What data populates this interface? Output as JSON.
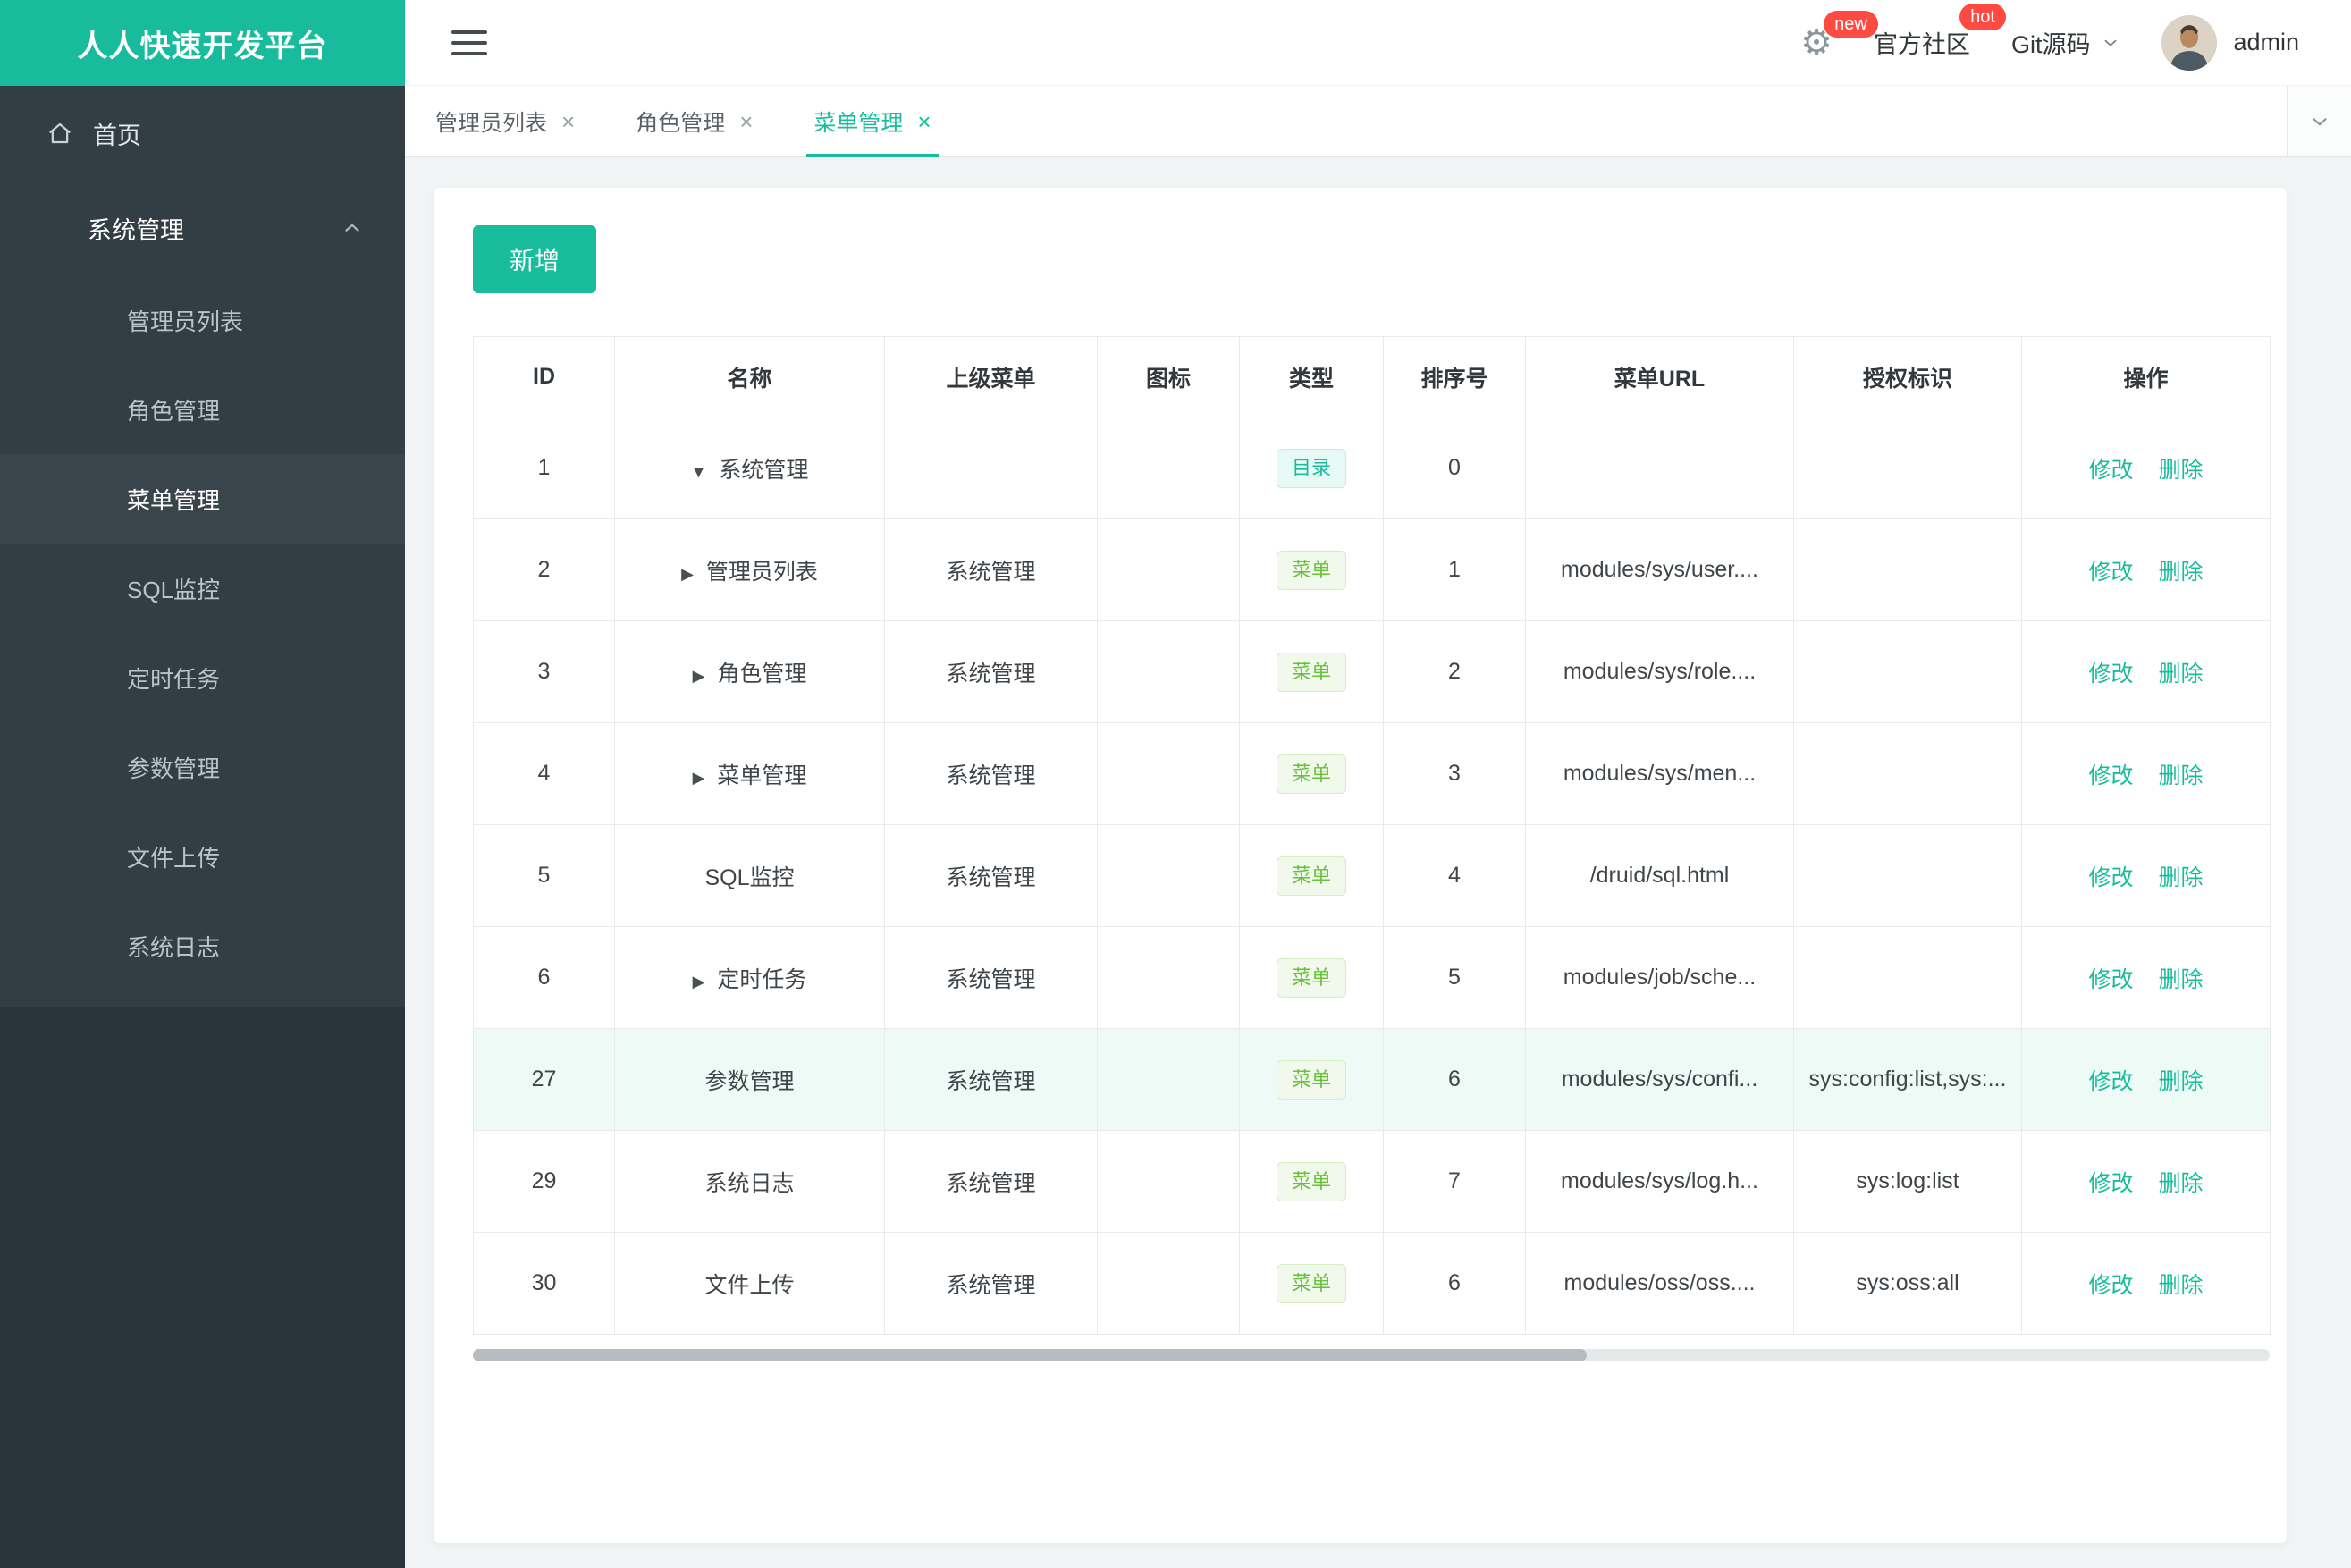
{
  "app": {
    "title": "人人快速开发平台"
  },
  "colors": {
    "accent": "#18bc9c",
    "badge_red": "#ff4a42",
    "sidebar_nav": "#323d44",
    "sidebar_deep": "#2a343b",
    "tag_directory_text": "#18bc9c",
    "tag_menu_text": "#67c23a"
  },
  "icons": {
    "gear": "⚙",
    "close": "×",
    "caret_down": "▼",
    "caret_right": "▶"
  },
  "topbar": {
    "gear_badge": "new",
    "community_label": "官方社区",
    "community_badge": "hot",
    "git_label": "Git源码",
    "user_name": "admin"
  },
  "sidebar": {
    "home_label": "首页",
    "group_label": "系统管理",
    "items": [
      {
        "label": "管理员列表",
        "active": false
      },
      {
        "label": "角色管理",
        "active": false
      },
      {
        "label": "菜单管理",
        "active": true
      },
      {
        "label": "SQL监控",
        "active": false
      },
      {
        "label": "定时任务",
        "active": false
      },
      {
        "label": "参数管理",
        "active": false
      },
      {
        "label": "文件上传",
        "active": false
      },
      {
        "label": "系统日志",
        "active": false
      }
    ]
  },
  "tabs": [
    {
      "label": "管理员列表",
      "active": false
    },
    {
      "label": "角色管理",
      "active": false
    },
    {
      "label": "菜单管理",
      "active": true
    }
  ],
  "toolbar": {
    "add_label": "新增"
  },
  "table": {
    "headers": [
      "ID",
      "名称",
      "上级菜单",
      "图标",
      "类型",
      "排序号",
      "菜单URL",
      "授权标识",
      "操作"
    ],
    "actions": {
      "edit": "修改",
      "delete": "删除"
    },
    "rows": [
      {
        "id": "1",
        "caret": "down",
        "name": "系统管理",
        "parent": "",
        "icon": "",
        "type": "目录",
        "type_kind": "directory",
        "order": "0",
        "url": "",
        "perms": "",
        "highlight": false
      },
      {
        "id": "2",
        "caret": "right",
        "name": "管理员列表",
        "parent": "系统管理",
        "icon": "",
        "type": "菜单",
        "type_kind": "menu",
        "order": "1",
        "url": "modules/sys/user....",
        "perms": "",
        "highlight": false
      },
      {
        "id": "3",
        "caret": "right",
        "name": "角色管理",
        "parent": "系统管理",
        "icon": "",
        "type": "菜单",
        "type_kind": "menu",
        "order": "2",
        "url": "modules/sys/role....",
        "perms": "",
        "highlight": false
      },
      {
        "id": "4",
        "caret": "right",
        "name": "菜单管理",
        "parent": "系统管理",
        "icon": "",
        "type": "菜单",
        "type_kind": "menu",
        "order": "3",
        "url": "modules/sys/men...",
        "perms": "",
        "highlight": false
      },
      {
        "id": "5",
        "caret": "",
        "name": "SQL监控",
        "parent": "系统管理",
        "icon": "",
        "type": "菜单",
        "type_kind": "menu",
        "order": "4",
        "url": "/druid/sql.html",
        "perms": "",
        "highlight": false
      },
      {
        "id": "6",
        "caret": "right",
        "name": "定时任务",
        "parent": "系统管理",
        "icon": "",
        "type": "菜单",
        "type_kind": "menu",
        "order": "5",
        "url": "modules/job/sche...",
        "perms": "",
        "highlight": false
      },
      {
        "id": "27",
        "caret": "",
        "name": "参数管理",
        "parent": "系统管理",
        "icon": "",
        "type": "菜单",
        "type_kind": "menu",
        "order": "6",
        "url": "modules/sys/confi...",
        "perms": "sys:config:list,sys:...",
        "highlight": true
      },
      {
        "id": "29",
        "caret": "",
        "name": "系统日志",
        "parent": "系统管理",
        "icon": "",
        "type": "菜单",
        "type_kind": "menu",
        "order": "7",
        "url": "modules/sys/log.h...",
        "perms": "sys:log:list",
        "highlight": false
      },
      {
        "id": "30",
        "caret": "",
        "name": "文件上传",
        "parent": "系统管理",
        "icon": "",
        "type": "菜单",
        "type_kind": "menu",
        "order": "6",
        "url": "modules/oss/oss....",
        "perms": "sys:oss:all",
        "highlight": false
      }
    ]
  }
}
